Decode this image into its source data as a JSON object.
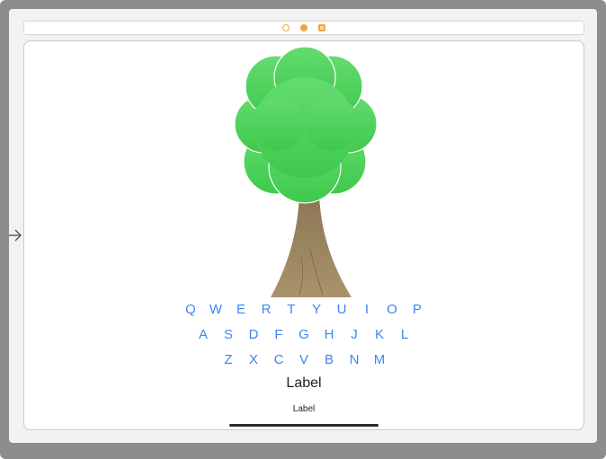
{
  "scene_dock": {
    "icons": [
      "view-controller-icon",
      "first-responder-icon",
      "exit-icon"
    ],
    "accent_color": "#f0a640"
  },
  "entry_point": {
    "icon": "arrow-right-icon"
  },
  "tree_image": {
    "icon": "tree-icon",
    "foliage_color": "#4cd15c",
    "trunk_color": "#9a8460"
  },
  "keyboard": {
    "key_color": "#3a86f5",
    "rows": [
      [
        "Q",
        "W",
        "E",
        "R",
        "T",
        "Y",
        "U",
        "I",
        "O",
        "P"
      ],
      [
        "A",
        "S",
        "D",
        "F",
        "G",
        "H",
        "J",
        "K",
        "L"
      ],
      [
        "Z",
        "X",
        "C",
        "V",
        "B",
        "N",
        "M"
      ]
    ]
  },
  "labels": {
    "large": "Label",
    "small": "Label"
  }
}
